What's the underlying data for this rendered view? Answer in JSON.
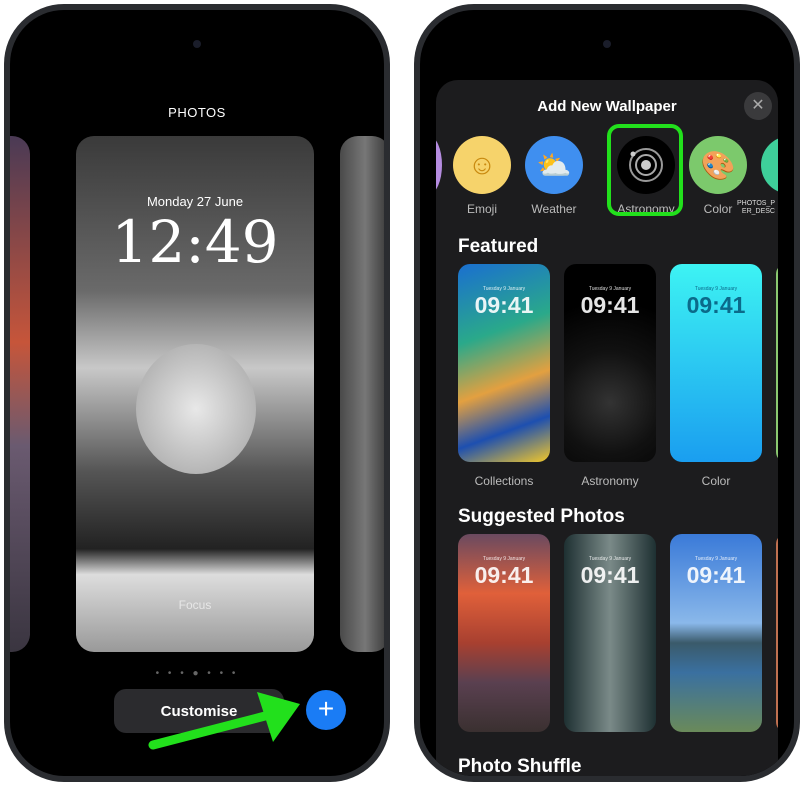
{
  "left_phone": {
    "title": "PHOTOS",
    "lock_date": "Monday 27 June",
    "lock_time": "12:49",
    "focus_label": "Focus",
    "customise_label": "Customise",
    "add_icon": "plus-icon",
    "page_dots": 7,
    "active_dot": 4
  },
  "right_phone": {
    "sheet_title": "Add New Wallpaper",
    "close_icon": "close-icon",
    "categories": [
      {
        "label": "Emoji",
        "icon": "smiley-icon",
        "color": "#f6d36b"
      },
      {
        "label": "Weather",
        "icon": "cloud-sun-icon",
        "color": "#3f8ff0"
      },
      {
        "label": "Astronomy",
        "icon": "orbit-icon",
        "color": "#000000",
        "highlighted": true
      },
      {
        "label": "Color",
        "icon": "palette-icon",
        "color": "#7cc96c"
      },
      {
        "label": "PHOTOS_PER_DESC",
        "icon": "person-icon",
        "color": "#3ecf9a"
      }
    ],
    "featured_title": "Featured",
    "featured": [
      {
        "label": "Collections",
        "date": "Tuesday 9 January",
        "time": "09:41"
      },
      {
        "label": "Astronomy",
        "date": "Tuesday 9 January",
        "time": "09:41"
      },
      {
        "label": "Color",
        "date": "Tuesday 9 January",
        "time": "09:41"
      }
    ],
    "suggested_title": "Suggested Photos",
    "suggested": [
      {
        "date": "Tuesday 9 January",
        "time": "09:41"
      },
      {
        "date": "Tuesday 9 January",
        "time": "09:41"
      },
      {
        "date": "Tuesday 9 January",
        "time": "09:41"
      }
    ],
    "next_section_title": "Photo Shuffle"
  },
  "highlight_color": "#22e01c",
  "accent": "#1a7cf5"
}
